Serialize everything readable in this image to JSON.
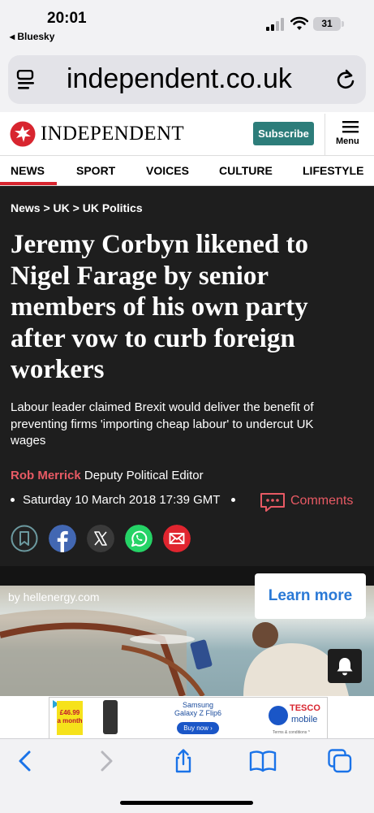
{
  "status_bar": {
    "time": "20:01",
    "back_app": "◂ Bluesky",
    "battery": "31"
  },
  "browser": {
    "url": "independent.co.uk"
  },
  "site": {
    "logo_text": "INDEPENDENT",
    "subscribe_label": "Subscribe",
    "menu_label": "Menu",
    "brand_color": "#d8252f",
    "accent_color": "#2d7d7a"
  },
  "nav": {
    "items": [
      "NEWS",
      "SPORT",
      "VOICES",
      "CULTURE",
      "LIFESTYLE"
    ],
    "active": "NEWS"
  },
  "article": {
    "breadcrumb": "News > UK > UK Politics",
    "headline_lines": [
      "Jeremy Corbyn likened to",
      "Nigel Farage by senior",
      "members of his own party",
      "after vow to curb foreign",
      "workers"
    ],
    "standfirst_lines": [
      "Labour leader claimed Brexit would deliver the benefit of",
      "preventing firms 'importing cheap labour' to undercut UK",
      "wages"
    ],
    "author": "Rob Merrick",
    "author_role": "Deputy Political Editor",
    "date": "Saturday 10 March 2018 17:39 GMT",
    "comments_label": "Comments",
    "share_icons": [
      "bookmark-icon",
      "facebook-icon",
      "x-icon",
      "whatsapp-icon",
      "email-icon"
    ]
  },
  "ad": {
    "source": "by hellenergy.com",
    "cta": "Learn more"
  },
  "banner_ad": {
    "price": "£46.99",
    "price_sub": "a month",
    "product_line1": "Samsung",
    "product_line2": "Galaxy Z Flip6",
    "buy_label": "Buy now ›",
    "brand": "TESCO",
    "brand_sub": "mobile",
    "terms": "Terms & conditions ^"
  },
  "toolbar": {
    "icons": [
      "back-icon",
      "forward-icon",
      "share-icon",
      "bookmarks-icon",
      "tabs-icon"
    ]
  }
}
